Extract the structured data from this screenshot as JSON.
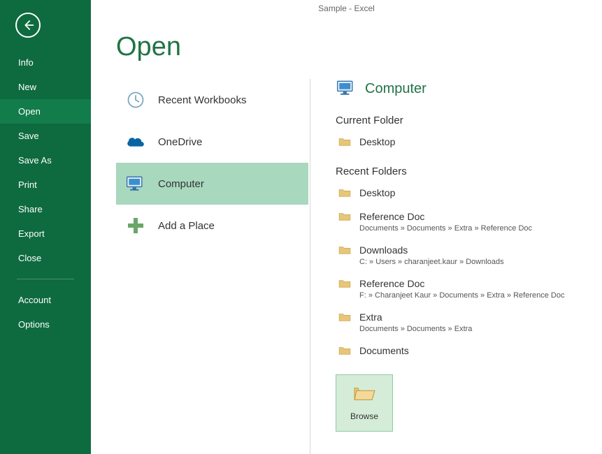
{
  "titlebar": {
    "title": "Sample - Excel"
  },
  "page": {
    "title": "Open"
  },
  "sidebar": {
    "items": [
      {
        "label": "Info"
      },
      {
        "label": "New"
      },
      {
        "label": "Open"
      },
      {
        "label": "Save"
      },
      {
        "label": "Save As"
      },
      {
        "label": "Print"
      },
      {
        "label": "Share"
      },
      {
        "label": "Export"
      },
      {
        "label": "Close"
      }
    ],
    "footer": [
      {
        "label": "Account"
      },
      {
        "label": "Options"
      }
    ]
  },
  "places": {
    "recent": {
      "label": "Recent Workbooks"
    },
    "onedrive": {
      "label": "OneDrive"
    },
    "computer": {
      "label": "Computer"
    },
    "add_place": {
      "label": "Add a Place"
    }
  },
  "location": {
    "heading": "Computer",
    "current_folder_label": "Current Folder",
    "recent_folders_label": "Recent Folders",
    "current_folder": {
      "name": "Desktop"
    },
    "recent_folders": [
      {
        "name": "Desktop",
        "path": ""
      },
      {
        "name": "Reference Doc",
        "path": "Documents » Documents » Extra » Reference Doc"
      },
      {
        "name": "Downloads",
        "path": "C: » Users » charanjeet.kaur » Downloads"
      },
      {
        "name": "Reference Doc",
        "path": "F: » Charanjeet Kaur » Documents » Extra » Reference Doc"
      },
      {
        "name": "Extra",
        "path": "Documents » Documents » Extra"
      },
      {
        "name": "Documents",
        "path": ""
      }
    ],
    "browse_label": "Browse"
  }
}
